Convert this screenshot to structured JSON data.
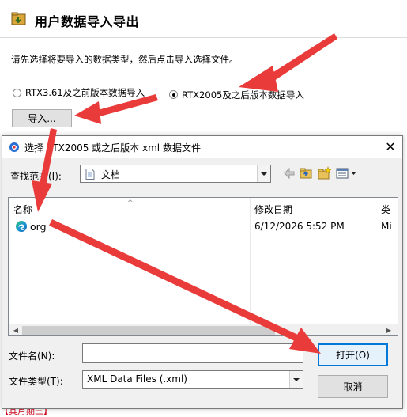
{
  "wizard": {
    "title": "用户数据导入导出",
    "instruction": "请先选择将要导入的数据类型，然后点击导入选择文件。",
    "radio_old_label": "RTX3.61及之前版本数据导入",
    "radio_new_label": "RTX2005及之后版本数据导入",
    "import_button": "导入...",
    "bottom_partial_text": "【其月期三】"
  },
  "dialog": {
    "title": "选择 RTX2005 或之后版本 xml 数据文件",
    "close_glyph": "✕",
    "lookin_label": "查找范围(I):",
    "lookin_value": "文档",
    "columns": [
      "名称",
      "修改日期",
      "类"
    ],
    "file": {
      "name": "org",
      "modified": "6/12/2026 5:52 PM",
      "type_partial": "Mi"
    },
    "filename_label": "文件名(N):",
    "filename_value": "",
    "filetype_label": "文件类型(T):",
    "filetype_value": "XML Data Files (.xml)",
    "open_button": "打开(O)",
    "cancel_button": "取消"
  },
  "colors": {
    "annotation_arrow": "#ea3b3b",
    "accent": "#0078d7"
  }
}
